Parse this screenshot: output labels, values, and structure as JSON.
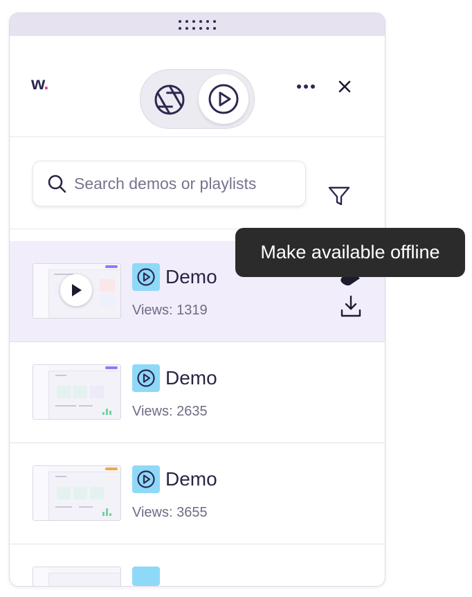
{
  "header": {
    "logo_text": "w",
    "mode_toggle": {
      "options": [
        {
          "icon": "camera-shutter-icon",
          "selected": false
        },
        {
          "icon": "play-circle-icon",
          "selected": true
        }
      ]
    },
    "more_icon": "more-horizontal-icon",
    "close_icon": "close-icon"
  },
  "search": {
    "placeholder": "Search demos or playlists",
    "value": "",
    "filter_icon": "filter-icon"
  },
  "tooltip": {
    "text": "Make available offline"
  },
  "items": [
    {
      "type_icon": "play-circle-icon",
      "title": "Demo",
      "views": "Views: 1319",
      "hovered": true
    },
    {
      "type_icon": "play-circle-icon",
      "title": "Demo",
      "views": "Views: 2635",
      "hovered": false
    },
    {
      "type_icon": "play-circle-icon",
      "title": "Demo",
      "views": "Views: 3655",
      "hovered": false
    }
  ],
  "colors": {
    "accent_purple": "#2d2751",
    "logo_dot": "#e0457b",
    "type_badge": "#8fd9f8",
    "hover_row": "#f1edfb",
    "drag_bar": "#e6e2ef"
  }
}
